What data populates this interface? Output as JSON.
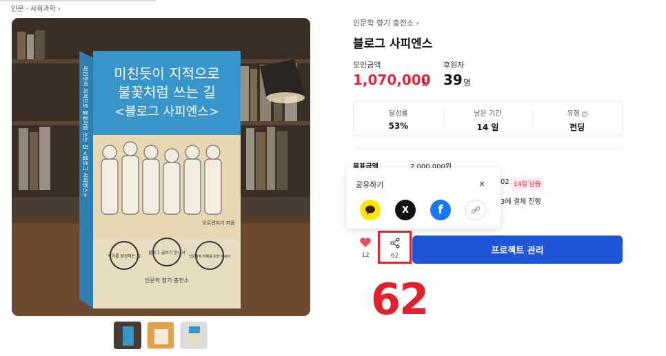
{
  "breadcrumb": "인문 · 사회과학 ›",
  "product_image": {
    "cover_title_line1": "미친듯이 지적으로",
    "cover_title_line2": "불꽃처럼 쓰는 길",
    "cover_title_line3": "<블로그 사피엔스>",
    "cover_author": "오르렌지기 저음",
    "cover_spine": "미친듯이 지적으로 불꽃처럼 쓰는 길 <블로그 사피엔스>",
    "badge1": "작가를 성장하는 길",
    "badge2": "블로그 글쓰기 안내서",
    "badge3": "인문학적 지혜를 위한 에세이",
    "publisher": "인문학 향기 충전소"
  },
  "creator": "인문학 향기 충전소 ›",
  "title": "블로그 사피엔스",
  "stats": {
    "amount_label": "모인금액",
    "amount": "1,070,000",
    "amount_unit": "원",
    "backers_label": "후원자",
    "backers": "39",
    "backers_unit": "명"
  },
  "info": {
    "rate_label": "달성률",
    "rate": "53%",
    "remaining_label": "남은 기간",
    "remaining": "14 일",
    "type_label": "유형",
    "type_icon": "i",
    "type": "펀딩"
  },
  "details": {
    "goal_label": "목표금액",
    "goal_value": "2,000,000원",
    "period_fragment": "02",
    "days_badge": "14일 남음",
    "payment_fragment": "3에 결제 진행"
  },
  "share_popup": {
    "title": "공유하기",
    "close": "×",
    "buttons": [
      "kakao-talk",
      "x",
      "facebook",
      "link"
    ],
    "x_label": "X",
    "facebook_label": "f"
  },
  "actions": {
    "like_count": "12",
    "share_count": "62",
    "manage_label": "프로젝트 관리"
  },
  "annotation": "62",
  "colors": {
    "accent_red": "#e5273b",
    "primary_blue": "#1f56d8",
    "kakao_yellow": "#fee500",
    "facebook_blue": "#1877f2",
    "highlight_box": "#e0232e"
  }
}
